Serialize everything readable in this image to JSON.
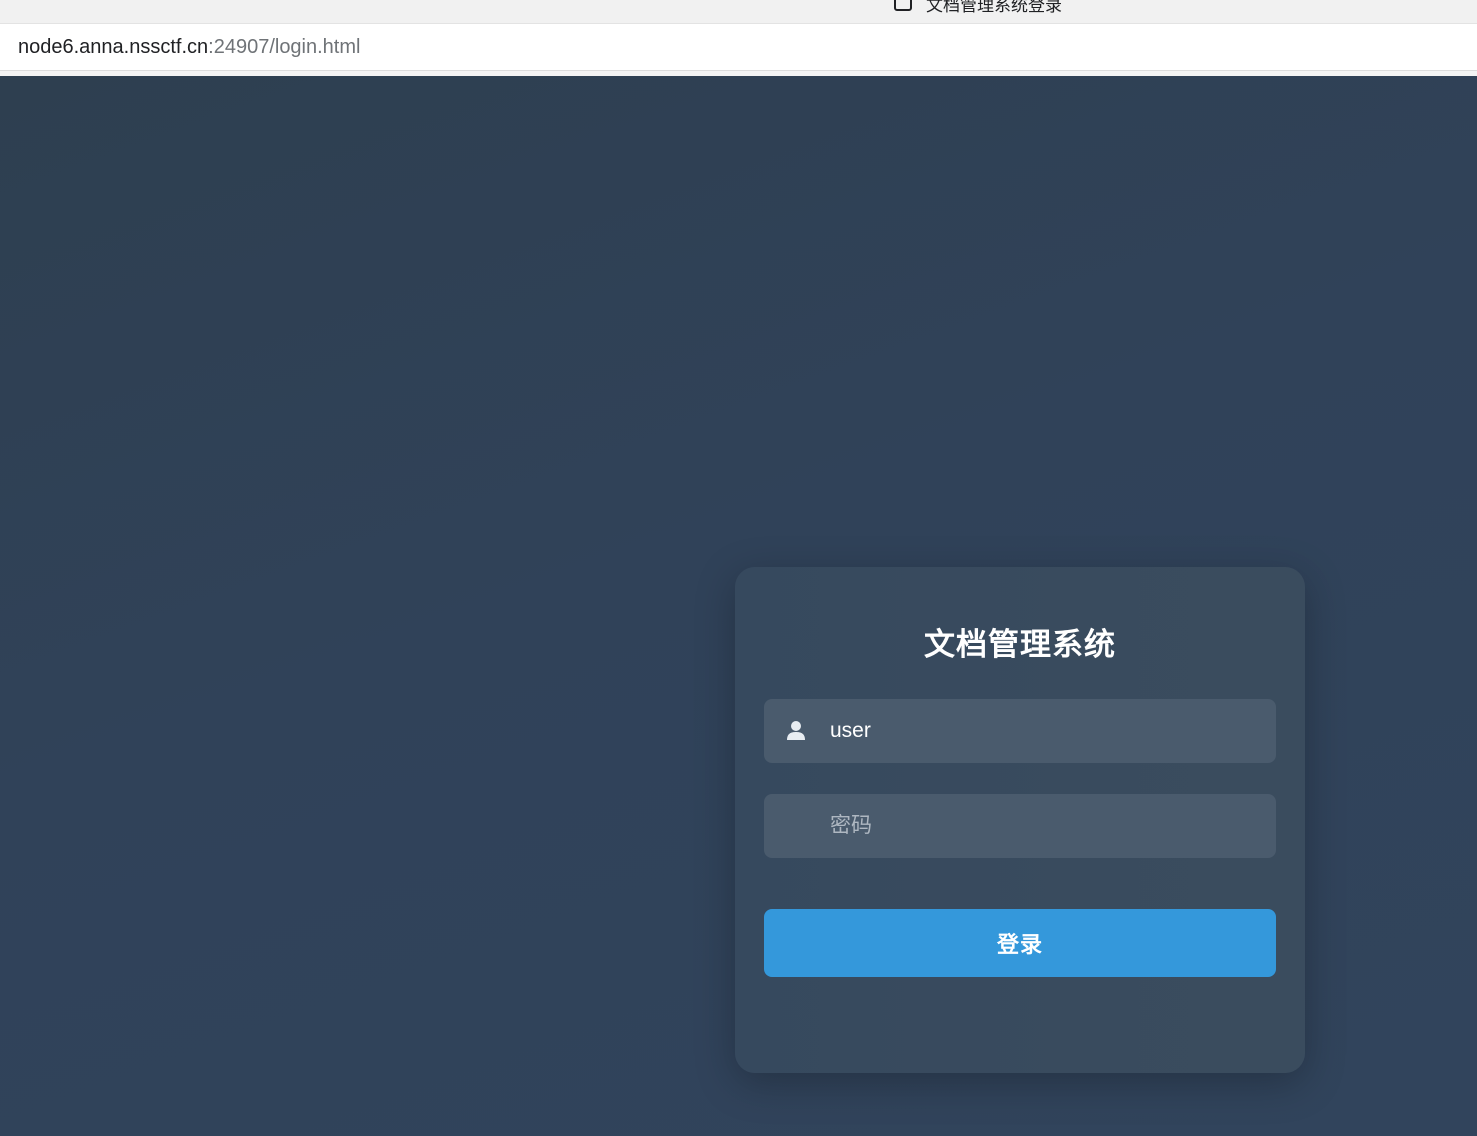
{
  "browser": {
    "tab_title": "文档管理系统登录",
    "url_host": "node6.anna.nssctf.cn",
    "url_rest": ":24907/login.html"
  },
  "login": {
    "title": "文档管理系统",
    "username_value": "user",
    "username_icon": "user-icon",
    "password_placeholder": "密码",
    "submit_label": "登录"
  },
  "colors": {
    "background": "#2f4156",
    "card": "#394b5e",
    "input": "#4a5b6d",
    "button": "#3498db"
  }
}
